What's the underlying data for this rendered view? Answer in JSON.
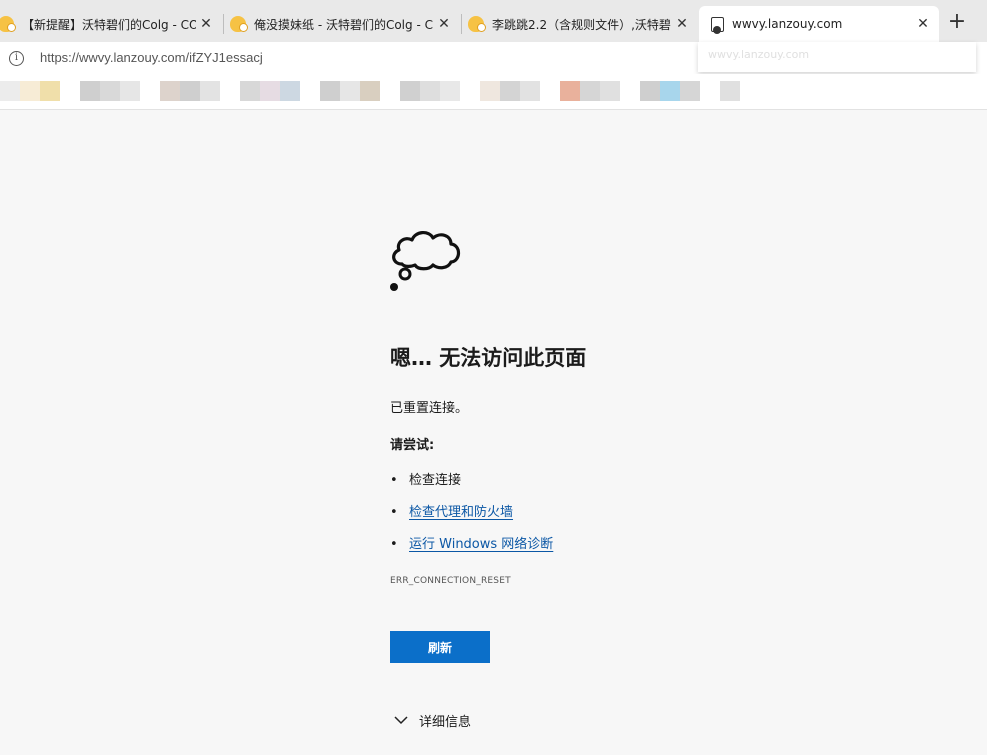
{
  "tabs": [
    {
      "title": "【新提醒】沃特碧们的Colg - COL",
      "close": "✕"
    },
    {
      "title": "俺没摸妹纸 - 沃特碧们的Colg - C",
      "close": "✕"
    },
    {
      "title": "李跳跳2.2（含规则文件）,沃特碧",
      "close": "✕"
    },
    {
      "title": "wwvy.lanzouy.com",
      "close": "✕"
    }
  ],
  "new_tab": "+",
  "address": {
    "info_icon": "i",
    "url": "https://wwvy.lanzouy.com/ifZYJ1essacj",
    "suggestion": "wwvy.lanzouy.com"
  },
  "favorites_bar": {
    "note_colors": [
      "#ececec",
      "#f7ecd6",
      "#f0dfaa",
      "#cfcfcf",
      "#d9d9d9",
      "#e6e6e6",
      "#ddd3cc",
      "#cfcfcf",
      "#e3e3e3",
      "#d8d8d8",
      "#e6dce3",
      "#cdd8e2",
      "#cfcfcf",
      "#e6e6e6",
      "#d9cfc0",
      "#d0d0d0",
      "#dedede",
      "#e8e8e8",
      "#efe7df",
      "#d4d4d4",
      "#e2e2e2",
      "#e9b19c",
      "#d6d6d6",
      "#e0e0e0",
      "#cfcfcf",
      "#a8d6ec",
      "#d6d6d6",
      "#e0e0e0"
    ]
  },
  "error": {
    "icon": "thought-cloud-icon",
    "heading": "嗯… 无法访问此页面",
    "reason": "已重置连接。",
    "try_label": "请尝试:",
    "bullet": "•",
    "suggestions": [
      {
        "text": "检查连接",
        "link": false
      },
      {
        "text": "检查代理和防火墙",
        "link": true
      },
      {
        "text": "运行 Windows 网络诊断",
        "link": true
      }
    ],
    "code": "ERR_CONNECTION_RESET",
    "refresh_label": "刷新",
    "details_label": "详细信息"
  },
  "colors": {
    "accent": "#0b6fc9",
    "link": "#0b57a5",
    "page_bg": "#f7f7f7"
  }
}
